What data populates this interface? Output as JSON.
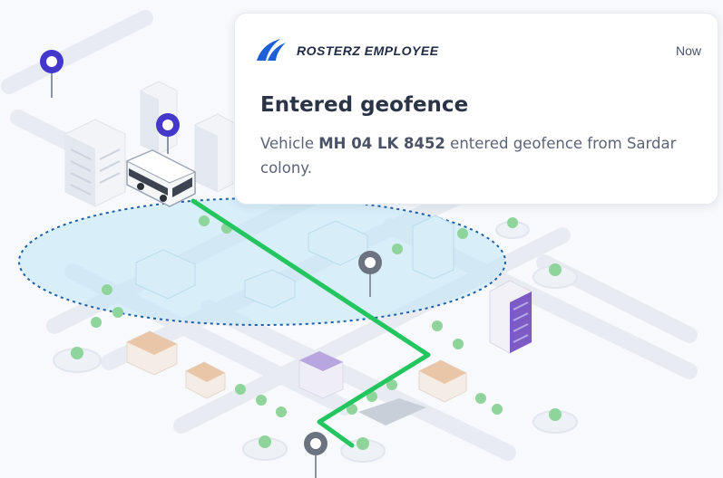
{
  "notification": {
    "app_name": "ROSTERZ EMPLOYEE",
    "time": "Now",
    "title": "Entered geofence",
    "body_prefix": "Vehicle",
    "vehicle_number": "MH 04 LK 8452",
    "body_suffix": "entered geofence from Sardar colony."
  },
  "map": {
    "route_color": "#22c55e",
    "geofence_fill": "#bfe6f5",
    "geofence_border": "#1d5fa8",
    "pin_active_color": "#4338ca",
    "pin_inactive_color": "#6b7280",
    "pin_icons": [
      "pin-icon",
      "pin-icon",
      "pin-icon",
      "pin-icon"
    ]
  },
  "colors": {
    "brand": "#1d5fd6"
  }
}
